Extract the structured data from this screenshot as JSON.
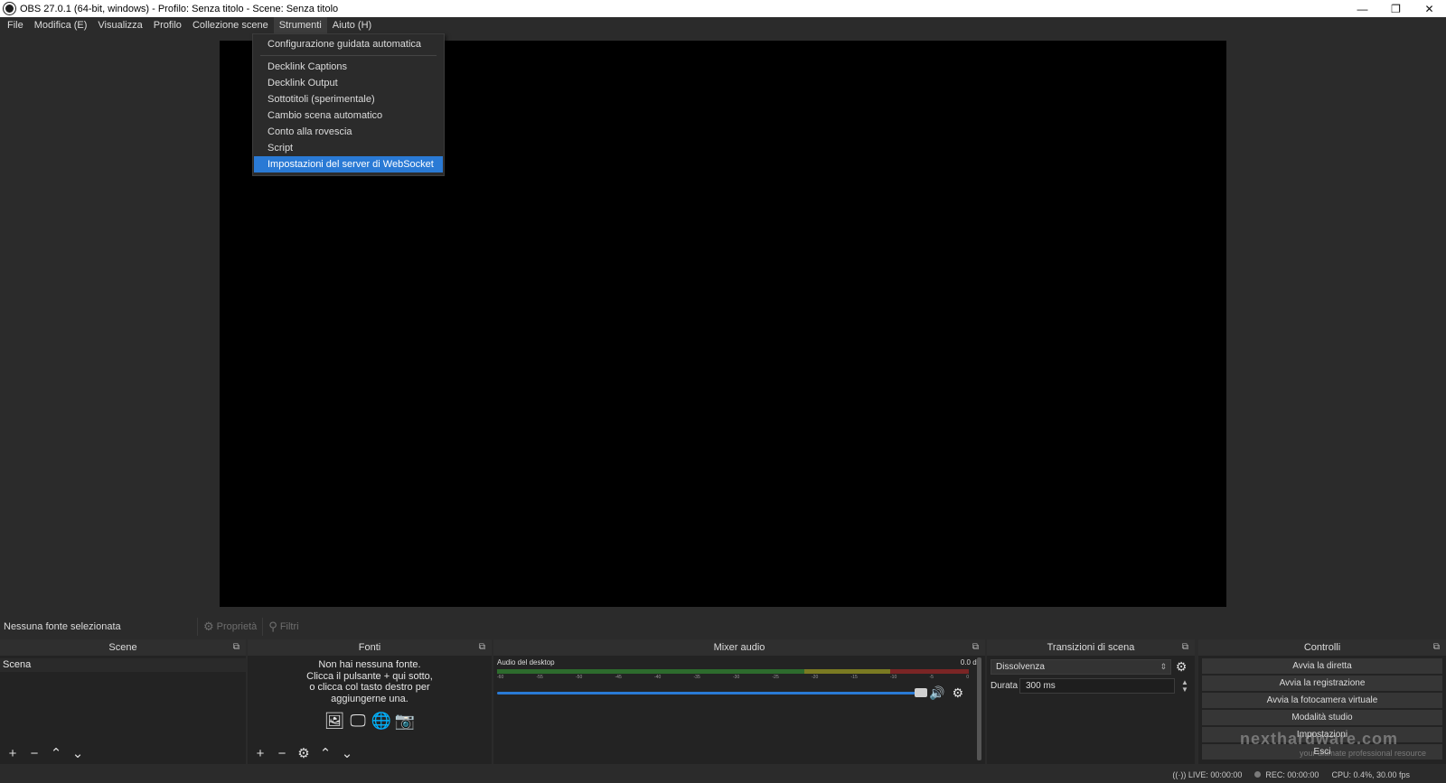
{
  "window": {
    "title": "OBS 27.0.1 (64-bit, windows) - Profilo: Senza titolo - Scene: Senza titolo",
    "minimize": "—",
    "restore": "❐",
    "close": "✕"
  },
  "menubar": {
    "items": [
      "File",
      "Modifica (E)",
      "Visualizza",
      "Profilo",
      "Collezione scene",
      "Strumenti",
      "Aiuto (H)"
    ]
  },
  "tools_menu": {
    "items": [
      "Configurazione guidata automatica",
      "Decklink Captions",
      "Decklink Output",
      "Sottotitoli (sperimentale)",
      "Cambio scena automatico",
      "Conto alla rovescia",
      "Script",
      "Impostazioni del server di WebSocket"
    ],
    "highlighted": "Impostazioni del server di WebSocket"
  },
  "contextbar": {
    "no_source": "Nessuna fonte selezionata",
    "properties": "Proprietà",
    "filters": "Filtri"
  },
  "scenes": {
    "title": "Scene",
    "items": [
      "Scena"
    ]
  },
  "sources": {
    "title": "Fonti",
    "empty_line1": "Non hai nessuna fonte.",
    "empty_line2": "Clicca il pulsante + qui sotto,",
    "empty_line3": "o clicca col tasto destro per",
    "empty_line4": "aggiungerne una."
  },
  "mixer": {
    "title": "Mixer audio",
    "track_name": "Audio del desktop",
    "track_db": "0.0 dB",
    "ticks": [
      "-60",
      "-55",
      "-50",
      "-45",
      "-40",
      "-35",
      "-30",
      "-25",
      "-20",
      "-15",
      "-10",
      "-5",
      "0"
    ],
    "volume_fraction": 1.0
  },
  "transitions": {
    "title": "Transizioni di scena",
    "selected": "Dissolvenza",
    "duration_label": "Durata",
    "duration_value": "300 ms"
  },
  "controls": {
    "title": "Controlli",
    "buttons": [
      "Avvia la diretta",
      "Avvia la registrazione",
      "Avvia la fotocamera virtuale",
      "Modalità studio",
      "Impostazioni",
      "Esci"
    ]
  },
  "watermark": {
    "brand": "nexthardware.com",
    "tagline": "your ultimate professional resource"
  },
  "statusbar": {
    "live": "LIVE: 00:00:00",
    "rec": "REC: 00:00:00",
    "cpu": "CPU: 0.4%, 30.00 fps"
  },
  "colors": {
    "highlight": "#2a7ad5",
    "background": "#2b2b2b",
    "preview": "#000000"
  }
}
